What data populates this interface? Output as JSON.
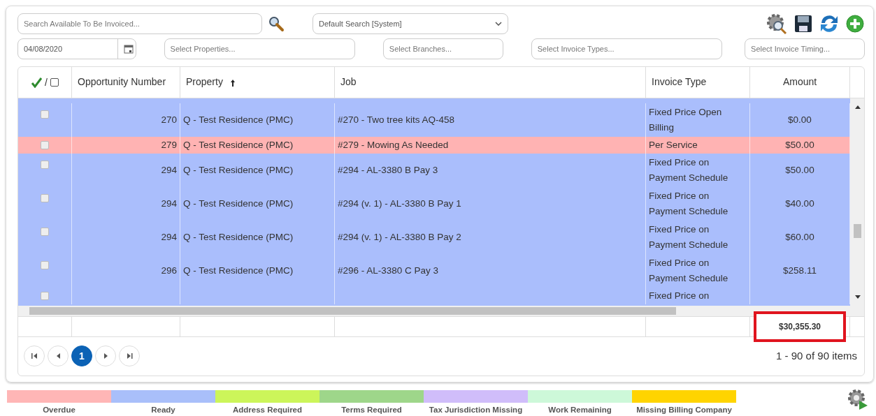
{
  "toolbar": {
    "search": {
      "placeholder": "Search Available To Be Invoiced..."
    },
    "saved_search": {
      "value": "Default Search [System]"
    },
    "date": {
      "value": "04/08/2020"
    },
    "filters": [
      {
        "placeholder": "Select Properties..."
      },
      {
        "placeholder": "Select Branches..."
      },
      {
        "placeholder": "Select Invoice Types..."
      },
      {
        "placeholder": "Select Invoice Timing..."
      }
    ]
  },
  "grid": {
    "header_separator": "/",
    "select_all_checked": false,
    "columns": [
      {
        "label": "Opportunity Number",
        "sorted": false
      },
      {
        "label": "Property",
        "sorted": true
      },
      {
        "label": "Job",
        "sorted": false
      },
      {
        "label": "Invoice Type",
        "sorted": false
      },
      {
        "label": "Amount",
        "sorted": false
      }
    ],
    "rows": [
      {
        "checked": false,
        "color": "#aabefc",
        "opportunity": "270",
        "property": "Q - Test Residence (PMC)",
        "job": "#270 - Two tree kits AQ-458",
        "invoice_type": [
          "Fixed Price Open",
          "Billing"
        ],
        "amount": "$0.00"
      },
      {
        "checked": false,
        "color": "#ffb3b3",
        "opportunity": "279",
        "property": "Q - Test Residence (PMC)",
        "job": "#279 - Mowing As Needed",
        "invoice_type": [
          "Per Service"
        ],
        "amount": "$50.00"
      },
      {
        "checked": false,
        "color": "#aabefc",
        "opportunity": "294",
        "property": "Q - Test Residence (PMC)",
        "job": "#294 - AL-3380 B Pay 3",
        "invoice_type": [
          "Fixed Price on",
          "Payment Schedule"
        ],
        "amount": "$50.00"
      },
      {
        "checked": false,
        "color": "#aabefc",
        "opportunity": "294",
        "property": "Q - Test Residence (PMC)",
        "job": "#294 (v. 1) - AL-3380 B Pay 1",
        "invoice_type": [
          "Fixed Price on",
          "Payment Schedule"
        ],
        "amount": "$40.00"
      },
      {
        "checked": false,
        "color": "#aabefc",
        "opportunity": "294",
        "property": "Q - Test Residence (PMC)",
        "job": "#294 (v. 1) - AL-3380 B Pay 2",
        "invoice_type": [
          "Fixed Price on",
          "Payment Schedule"
        ],
        "amount": "$60.00"
      },
      {
        "checked": false,
        "color": "#aabefc",
        "opportunity": "296",
        "property": "Q - Test Residence (PMC)",
        "job": "#296 - AL-3380 C Pay 3",
        "invoice_type": [
          "Fixed Price on",
          "Payment Schedule"
        ],
        "amount": "$258.11"
      },
      {
        "checked": false,
        "color": "#aabefc",
        "opportunity": "",
        "property": "",
        "job": "",
        "invoice_type": [
          "Fixed Price on"
        ],
        "amount": ""
      }
    ],
    "total": "$30,355.30",
    "total_highlighted": true
  },
  "pager": {
    "pages": [
      {
        "label": "1",
        "selected": true
      }
    ],
    "summary": "1 - 90 of 90 items"
  },
  "legend": [
    {
      "label": "Overdue",
      "color": "#ffb6b6"
    },
    {
      "label": "Ready",
      "color": "#a9bffa"
    },
    {
      "label": "Address Required",
      "color": "#ccf55a"
    },
    {
      "label": "Terms Required",
      "color": "#9ed68a"
    },
    {
      "label": "Tax Jurisdiction Missing",
      "color": "#d0bdfa"
    },
    {
      "label": "Work Remaining",
      "color": "#cdf8d9"
    },
    {
      "label": "Missing Billing Company",
      "color": "#ffd400"
    }
  ]
}
